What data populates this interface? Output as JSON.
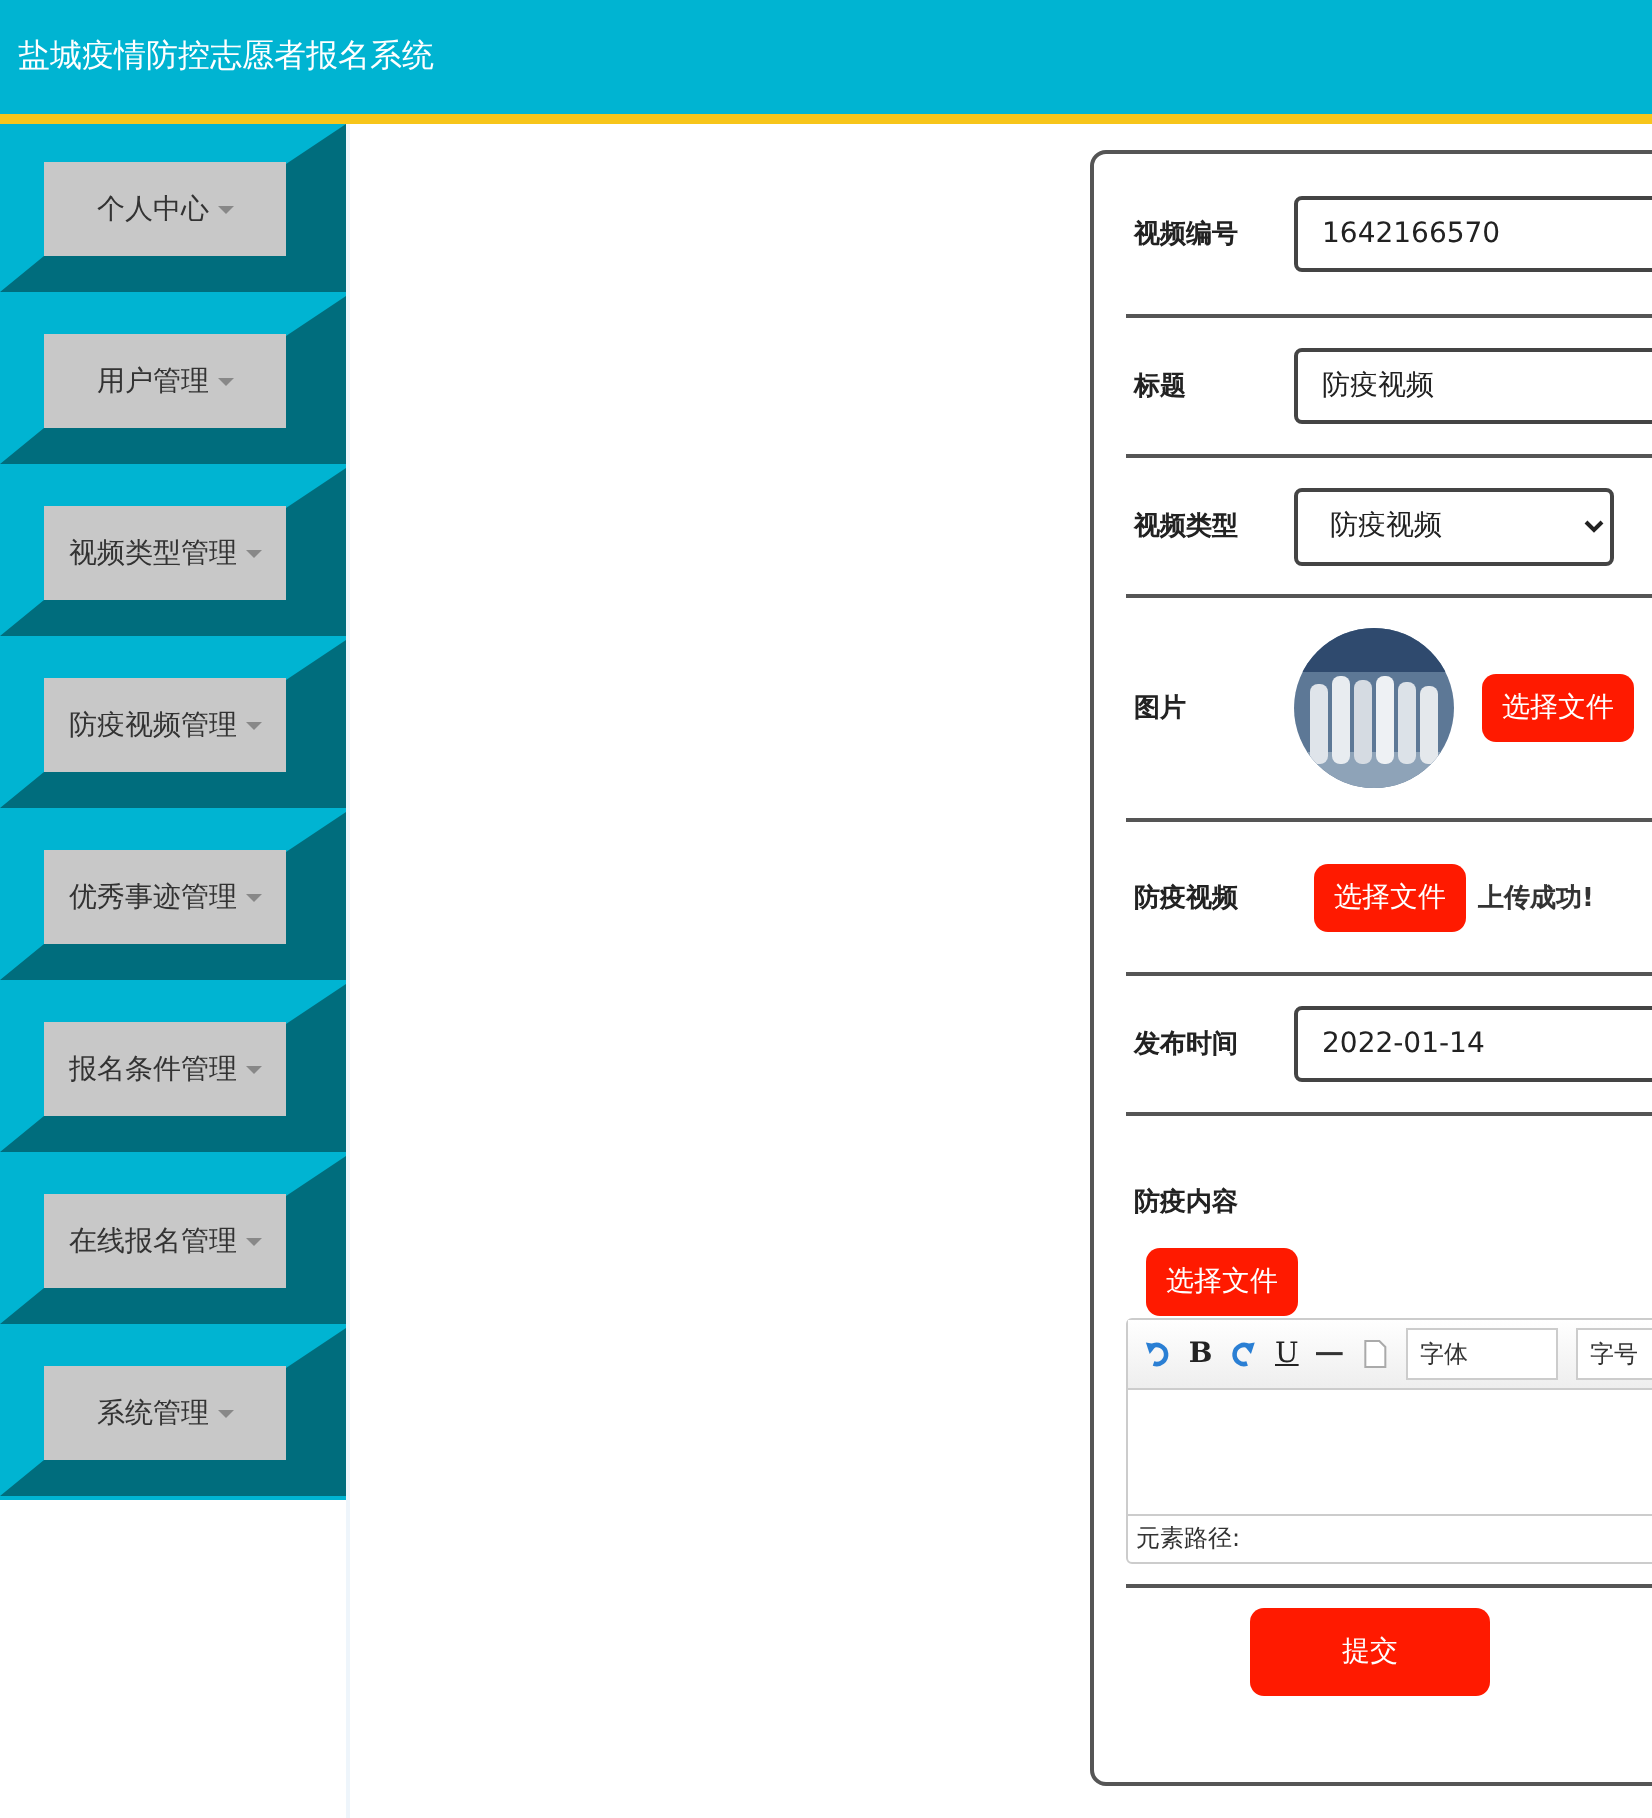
{
  "header": {
    "title": "盐城疫情防控志愿者报名系统"
  },
  "sidebar": {
    "items": [
      {
        "label": "个人中心"
      },
      {
        "label": "用户管理"
      },
      {
        "label": "视频类型管理"
      },
      {
        "label": "防疫视频管理"
      },
      {
        "label": "优秀事迹管理"
      },
      {
        "label": "报名条件管理"
      },
      {
        "label": "在线报名管理"
      },
      {
        "label": "系统管理"
      }
    ]
  },
  "form": {
    "fields": [
      {
        "kind": "text",
        "label": "视频编号",
        "value": "1642166570"
      },
      {
        "kind": "text",
        "label": "标题",
        "value": "防疫视频"
      },
      {
        "kind": "select",
        "label": "视频类型",
        "value": "防疫视频"
      },
      {
        "label": "图片",
        "button": "选择文件"
      },
      {
        "kind": "file",
        "label": "防疫视频",
        "button": "选择文件",
        "status": "上传成功!"
      },
      {
        "kind": "text",
        "label": "发布时间",
        "value": "2022-01-14"
      },
      {
        "kind": "editor",
        "label": "防疫内容",
        "button": "选择文件",
        "footer": "元素路径:",
        "toolbar": [
          {
            "kind": "undo"
          },
          {
            "kind": "bold",
            "label": "B"
          },
          {
            "kind": "redo"
          },
          {
            "kind": "underline",
            "label": "U"
          },
          {
            "kind": "hr"
          },
          {
            "kind": "page"
          },
          {
            "kind": "select",
            "label": "字体"
          },
          {
            "kind": "select",
            "label": "字号"
          }
        ]
      }
    ],
    "submit": "提交"
  }
}
